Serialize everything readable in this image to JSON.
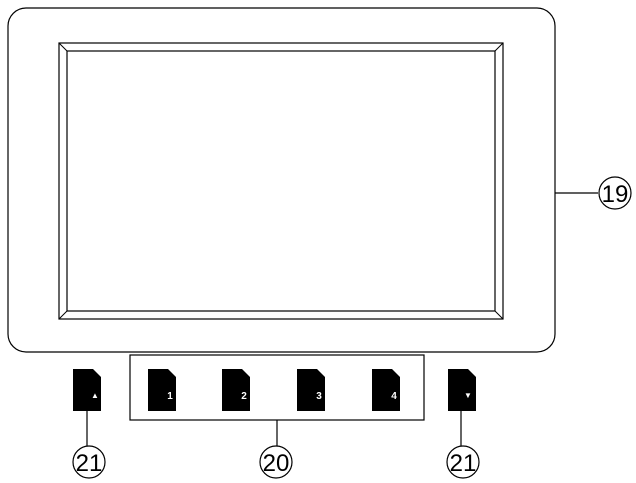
{
  "callouts": {
    "monitor": "19",
    "number_buttons": "20",
    "scroll_up": "21",
    "scroll_down": "21"
  },
  "buttons": {
    "up_glyph": "▲",
    "down_glyph": "▼",
    "numbers": [
      "1",
      "2",
      "3",
      "4"
    ]
  },
  "colors": {
    "line": "#000000",
    "frame_fill": "#ffffff",
    "button_fill": "#000000",
    "button_text": "#ffffff"
  }
}
